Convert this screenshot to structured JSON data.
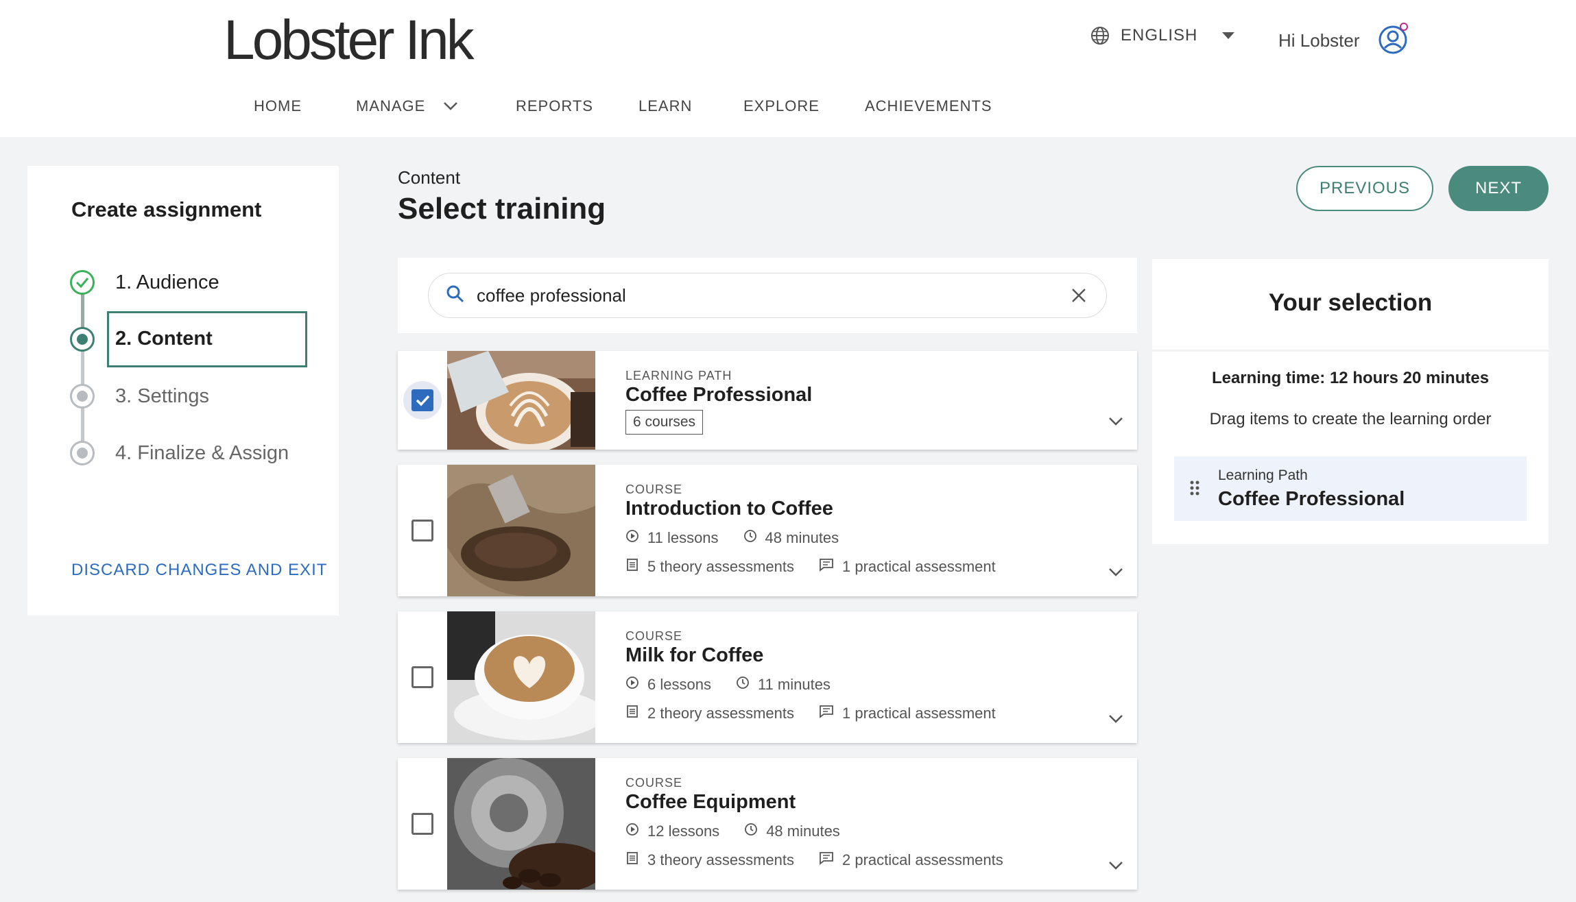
{
  "header": {
    "logo": "Lobster Ink",
    "language": "ENGLISH",
    "greeting": "Hi Lobster",
    "nav": [
      {
        "label": "HOME"
      },
      {
        "label": "MANAGE"
      },
      {
        "label": "REPORTS"
      },
      {
        "label": "LEARN"
      },
      {
        "label": "EXPLORE"
      },
      {
        "label": "ACHIEVEMENTS"
      }
    ]
  },
  "sidebar": {
    "title": "Create assignment",
    "steps": [
      {
        "label": "1. Audience",
        "state": "done"
      },
      {
        "label": "2. Content",
        "state": "current"
      },
      {
        "label": "3. Settings",
        "state": "todo"
      },
      {
        "label": "4. Finalize & Assign",
        "state": "todo"
      }
    ],
    "discard_label": "DISCARD CHANGES AND EXIT"
  },
  "main": {
    "breadcrumb": "Content",
    "title": "Select training",
    "previous_label": "PREVIOUS",
    "next_label": "NEXT",
    "search": {
      "value": "coffee professional",
      "placeholder": ""
    },
    "results": [
      {
        "kind": "LEARNING PATH",
        "title": "Coffee Professional",
        "tag": "6 courses",
        "checked": true
      },
      {
        "kind": "COURSE",
        "title": "Introduction to Coffee",
        "lessons": "11 lessons",
        "duration": "48 minutes",
        "theory": "5 theory assessments",
        "practical": "1 practical assessment",
        "checked": false
      },
      {
        "kind": "COURSE",
        "title": "Milk for Coffee",
        "lessons": "6 lessons",
        "duration": "11 minutes",
        "theory": "2 theory assessments",
        "practical": "1 practical assessment",
        "checked": false
      },
      {
        "kind": "COURSE",
        "title": "Coffee Equipment",
        "lessons": "12 lessons",
        "duration": "48 minutes",
        "theory": "3 theory assessments",
        "practical": "2 practical assessments",
        "checked": false
      }
    ]
  },
  "selection": {
    "title": "Your selection",
    "learning_time": "Learning time: 12 hours 20 minutes",
    "hint": "Drag items to create the learning order",
    "items": [
      {
        "kind": "Learning Path",
        "name": "Coffee Professional"
      }
    ]
  },
  "colors": {
    "accent": "#4a8b7e",
    "link": "#2d6bbf",
    "done": "#3bb25a",
    "background": "#f2f3f4"
  }
}
